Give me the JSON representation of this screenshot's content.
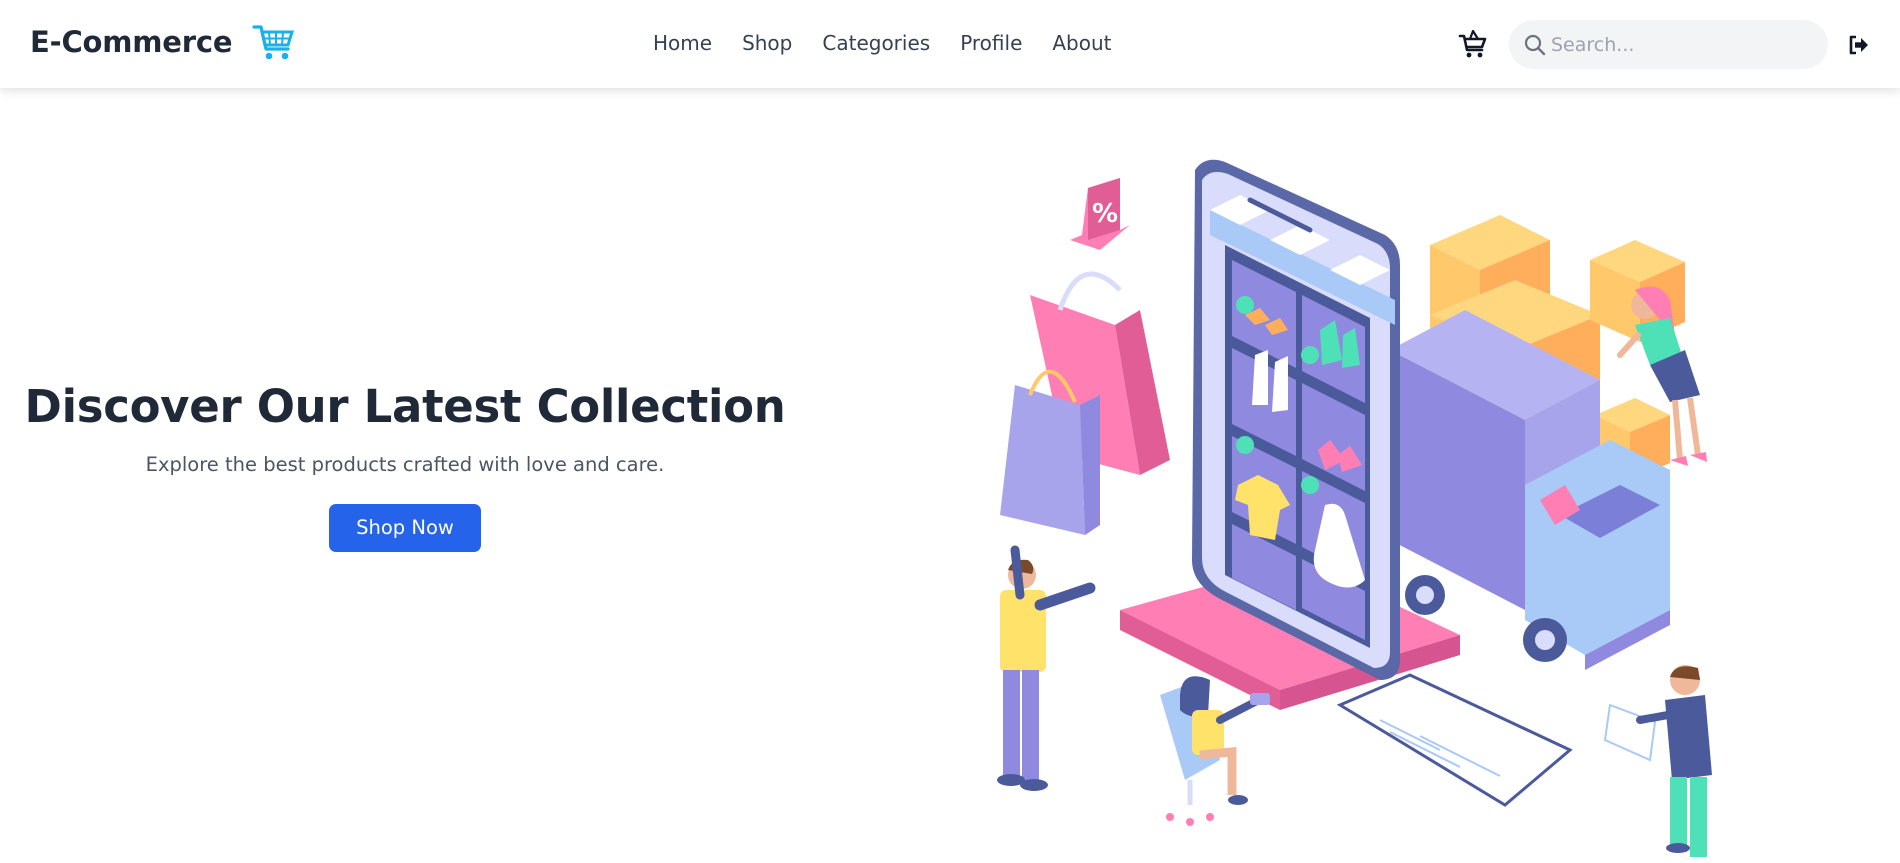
{
  "brand": {
    "name": "E-Commerce",
    "icon": "shopping-cart-icon",
    "icon_color": "#17b3e6"
  },
  "nav": {
    "links": [
      {
        "label": "Home"
      },
      {
        "label": "Shop"
      },
      {
        "label": "Categories"
      },
      {
        "label": "Profile"
      },
      {
        "label": "About"
      }
    ]
  },
  "header_actions": {
    "cart_icon": "cart-icon",
    "search": {
      "placeholder": "Search...",
      "value": "",
      "icon": "search-icon"
    },
    "logout_icon": "logout-icon"
  },
  "hero": {
    "title": "Discover Our Latest Collection",
    "subtitle": "Explore the best products crafted with love and care.",
    "cta_label": "Shop Now",
    "cta_color": "#2563eb"
  },
  "illustration": {
    "percent_tag": "%",
    "colors": {
      "pink": "#ff7fb4",
      "purple": "#8f8ae0",
      "lavender": "#d9ddfb",
      "navy": "#4b5a9b",
      "box": "#ffc86b",
      "teal": "#4ee0b6",
      "yellow": "#ffe26a"
    }
  }
}
